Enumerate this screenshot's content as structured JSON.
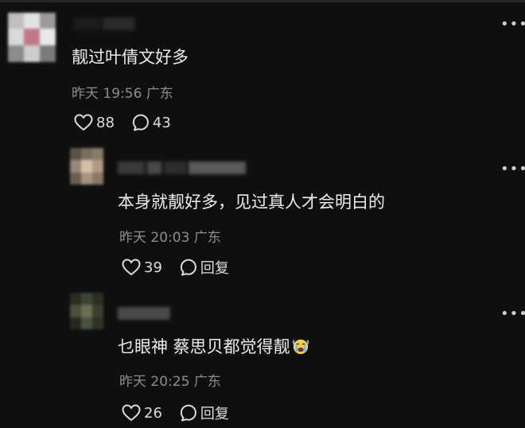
{
  "comments": [
    {
      "text": "靓过叶倩文好多",
      "time": "昨天 19:56",
      "location": "广东",
      "likes": "88",
      "replies": "43"
    },
    {
      "text": "本身就靓好多，见过真人才会明白的",
      "time": "昨天 20:03",
      "location": "广东",
      "likes": "39",
      "reply_label": "回复"
    },
    {
      "text": "乜眼神 蔡思贝都觉得靓",
      "emoji": "crying-face-emoji",
      "time": "昨天 20:25",
      "location": "广东",
      "likes": "26",
      "reply_label": "回复"
    }
  ],
  "more_glyph": "•••",
  "colors": {
    "background": "#0f0f0f",
    "text": "#ececec",
    "meta": "#8d8d8d"
  }
}
